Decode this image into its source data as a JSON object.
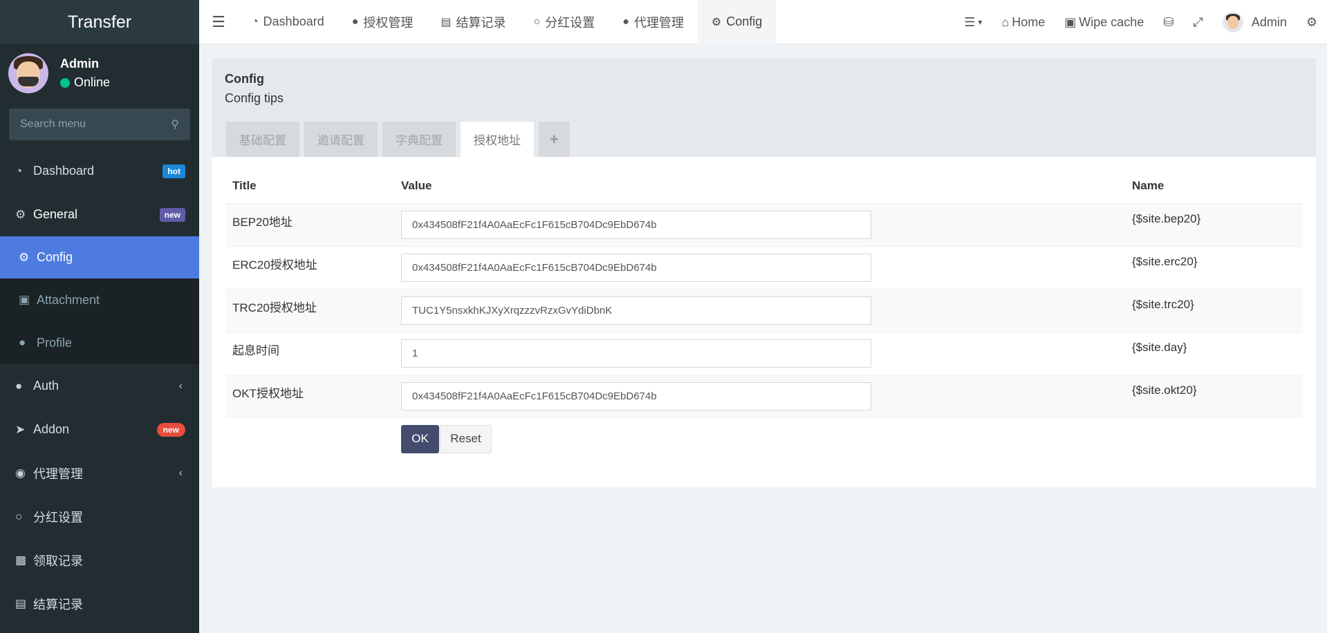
{
  "app": {
    "title": "Transfer"
  },
  "user": {
    "name": "Admin",
    "status": "Online"
  },
  "search": {
    "placeholder": "Search menu"
  },
  "sidebar": {
    "items": [
      {
        "label": "Dashboard",
        "badge": "hot",
        "icon": "dashboard-icon"
      },
      {
        "label": "General",
        "badge": "new",
        "icon": "cogs-icon"
      },
      {
        "label": "Config",
        "icon": "gear-icon"
      },
      {
        "label": "Attachment",
        "icon": "image-icon"
      },
      {
        "label": "Profile",
        "icon": "user-icon"
      },
      {
        "label": "Auth",
        "icon": "group-icon"
      },
      {
        "label": "Addon",
        "badge": "new",
        "icon": "rocket-icon"
      },
      {
        "label": "代理管理",
        "icon": "user-circle-icon"
      },
      {
        "label": "分红设置",
        "icon": "circle-icon"
      },
      {
        "label": "领取记录",
        "icon": "cake-icon"
      },
      {
        "label": "结算记录",
        "icon": "cc-icon"
      }
    ]
  },
  "topnav": {
    "tabs": [
      {
        "label": "Dashboard",
        "icon": "dashboard-icon"
      },
      {
        "label": "授权管理",
        "icon": "group-icon"
      },
      {
        "label": "结算记录",
        "icon": "cc-icon"
      },
      {
        "label": "分红设置",
        "icon": "circle-icon"
      },
      {
        "label": "代理管理",
        "icon": "user-icon"
      },
      {
        "label": "Config",
        "icon": "gear-icon"
      }
    ],
    "right": {
      "home": "Home",
      "wipe": "Wipe cache",
      "admin": "Admin"
    }
  },
  "panel": {
    "title": "Config",
    "tips": "Config tips",
    "subtabs": [
      "基础配置",
      "邀请配置",
      "字典配置",
      "授权地址",
      "+"
    ],
    "table": {
      "headers": {
        "title": "Title",
        "value": "Value",
        "name": "Name"
      },
      "rows": [
        {
          "title": "BEP20地址",
          "value": "0x434508fF21f4A0AaEcFc1F615cB704Dc9EbD674b",
          "name": "{$site.bep20}"
        },
        {
          "title": "ERC20授权地址",
          "value": "0x434508fF21f4A0AaEcFc1F615cB704Dc9EbD674b",
          "name": "{$site.erc20}"
        },
        {
          "title": "TRC20授权地址",
          "value": "TUC1Y5nsxkhKJXyXrqzzzvRzxGvYdiDbnK",
          "name": "{$site.trc20}"
        },
        {
          "title": "起息时间",
          "value": "1",
          "name": "{$site.day}"
        },
        {
          "title": "OKT授权地址",
          "value": "0x434508fF21f4A0AaEcFc1F615cB704Dc9EbD674b",
          "name": "{$site.okt20}"
        }
      ]
    },
    "buttons": {
      "ok": "OK",
      "reset": "Reset"
    }
  },
  "colors": {
    "sidebar_bg": "#222d32",
    "active_item": "#4d7be0",
    "ok_button": "#444c6e",
    "online_dot": "#00c28a"
  }
}
